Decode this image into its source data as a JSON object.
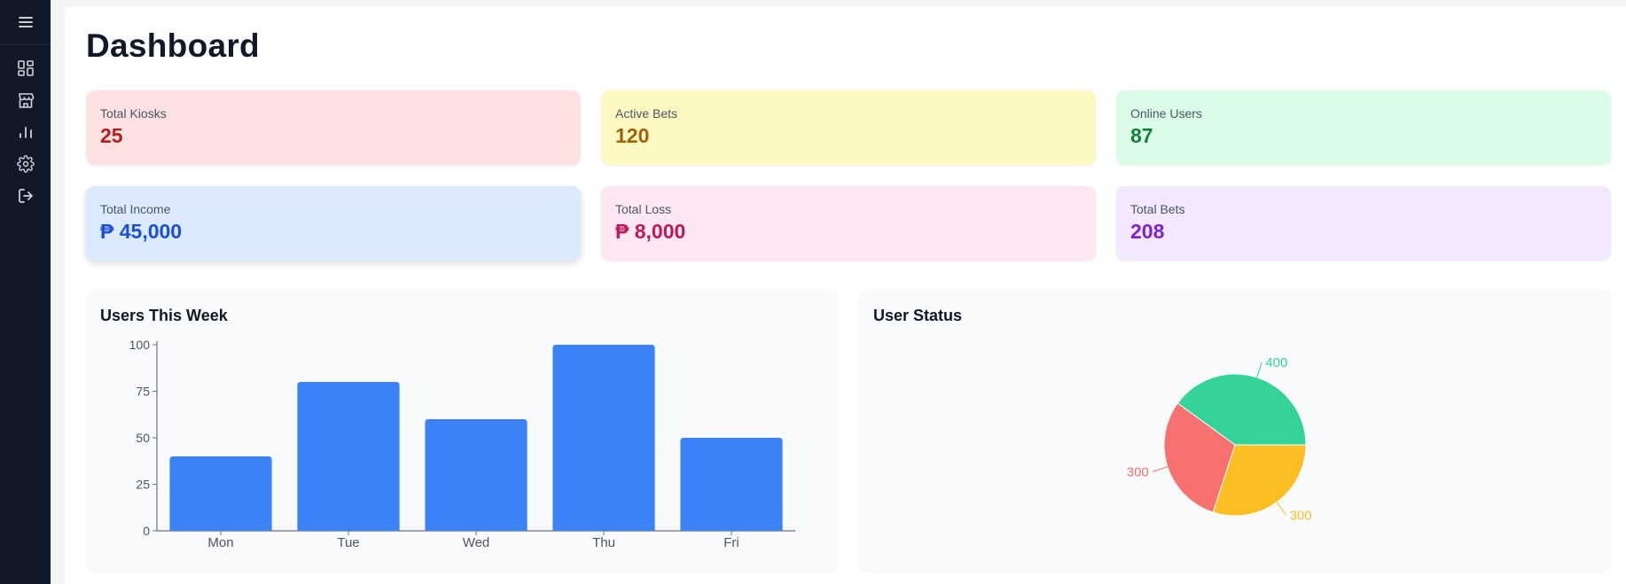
{
  "sidebar": {
    "menu_icon": "hamburger-menu-icon",
    "items": [
      {
        "icon": "dashboard-icon"
      },
      {
        "icon": "store-icon"
      },
      {
        "icon": "bar-chart-icon"
      },
      {
        "icon": "gear-icon"
      },
      {
        "icon": "logout-icon"
      }
    ]
  },
  "page": {
    "title": "Dashboard"
  },
  "stats": [
    {
      "label": "Total Kiosks",
      "value": "25",
      "bg": "#fee2e2",
      "color": "#b91c1c"
    },
    {
      "label": "Active Bets",
      "value": "120",
      "bg": "#fef9c3",
      "color": "#a16207"
    },
    {
      "label": "Online Users",
      "value": "87",
      "bg": "#dcfce7",
      "color": "#15803d"
    },
    {
      "label": "Total Income",
      "value": "₱ 45,000",
      "bg": "#dbeafe",
      "color": "#1d4ed8"
    },
    {
      "label": "Total Loss",
      "value": "₱ 8,000",
      "bg": "#fce7f3",
      "color": "#be185d"
    },
    {
      "label": "Total Bets",
      "value": "208",
      "bg": "#f3e8ff",
      "color": "#7e22ce"
    }
  ],
  "users_panel": {
    "title": "Users This Week"
  },
  "status_panel": {
    "title": "User Status"
  },
  "chart_data": [
    {
      "type": "bar",
      "title": "Users This Week",
      "categories": [
        "Mon",
        "Tue",
        "Wed",
        "Thu",
        "Fri"
      ],
      "values": [
        40,
        80,
        60,
        100,
        50
      ],
      "yticks": [
        "0",
        "25",
        "50",
        "75",
        "100"
      ],
      "ylim": [
        0,
        100
      ],
      "color": "#3b82f6",
      "grid": false
    },
    {
      "type": "pie",
      "title": "User Status",
      "values": [
        400,
        300,
        300
      ],
      "labels": [
        "400",
        "300",
        "300"
      ],
      "colors": [
        "#34d399",
        "#f87171",
        "#fbbf24"
      ]
    }
  ]
}
